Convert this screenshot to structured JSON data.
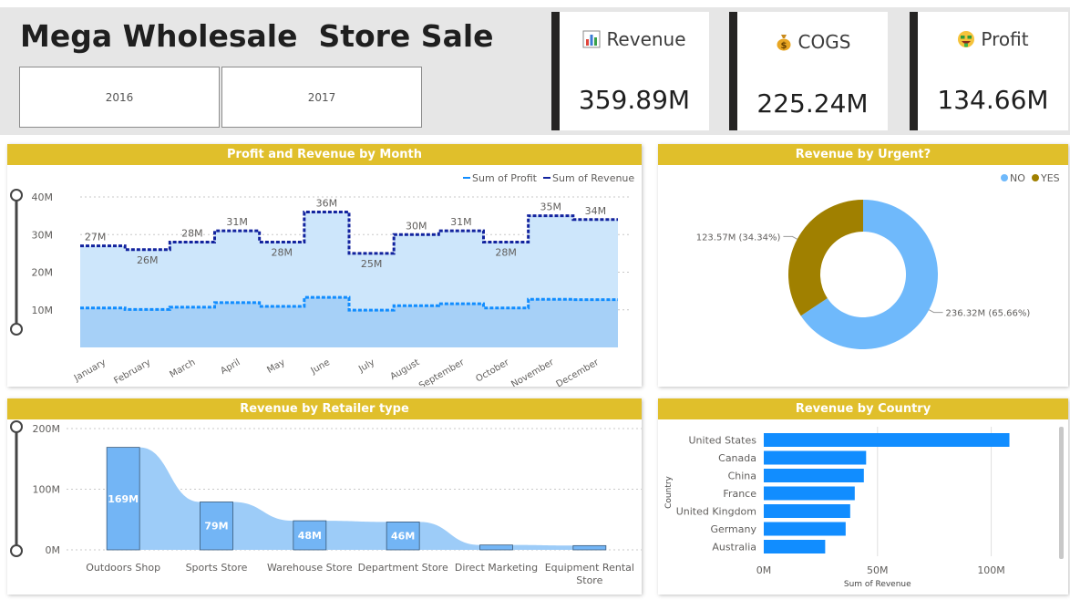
{
  "header": {
    "title": "Mega Wholesale  Store Sale",
    "slicers": [
      "2016",
      "2017"
    ]
  },
  "kpis": [
    {
      "label": "Revenue",
      "value": "359.89M",
      "icon": "bar-chart-icon"
    },
    {
      "label": "COGS",
      "value": "225.24M",
      "icon": "money-bag-icon"
    },
    {
      "label": "Profit",
      "value": "134.66M",
      "icon": "money-face-icon"
    }
  ],
  "colors": {
    "accent": "#e0bf2b",
    "revenue_line": "#12239e",
    "profit_line": "#118dff",
    "area_fill": "#cde6fb",
    "no": "#6fb9fb",
    "yes": "#a08000",
    "bar": "#118dff"
  },
  "panels": {
    "month": "Profit and Revenue by Month",
    "urgent": "Revenue by Urgent?",
    "retailer": "Revenue by Retailer type",
    "country": "Revenue by Country"
  },
  "chart_data": [
    {
      "type": "line",
      "title": "Profit and Revenue by Month",
      "categories": [
        "January",
        "February",
        "March",
        "April",
        "May",
        "June",
        "July",
        "August",
        "September",
        "October",
        "November",
        "December"
      ],
      "series": [
        {
          "name": "Sum of Profit",
          "values": [
            10.5,
            10.1,
            10.7,
            11.9,
            10.9,
            13.3,
            9.9,
            11.1,
            11.6,
            10.5,
            12.8,
            12.7
          ]
        },
        {
          "name": "Sum of Revenue",
          "values": [
            27,
            26,
            28,
            31,
            28,
            36,
            25,
            30,
            31,
            28,
            35,
            34
          ],
          "labels": [
            "27M",
            "26M",
            "28M",
            "31M",
            "28M",
            "36M",
            "25M",
            "30M",
            "31M",
            "28M",
            "35M",
            "34M"
          ]
        }
      ],
      "y_ticks": [
        "10M",
        "20M",
        "30M",
        "40M"
      ],
      "ylim": [
        0,
        40
      ],
      "legend": "top-right",
      "grid": true
    },
    {
      "type": "pie",
      "title": "Revenue by Urgent?",
      "slices": [
        {
          "name": "NO",
          "value": 236.32,
          "label": "236.32M (65.66%)"
        },
        {
          "name": "YES",
          "value": 123.57,
          "label": "123.57M (34.34%)"
        }
      ],
      "legend": "top-right"
    },
    {
      "type": "bar",
      "title": "Revenue by Retailer type",
      "categories": [
        "Outdoors Shop",
        "Sports Store",
        "Warehouse Store",
        "Department Store",
        "Direct Marketing",
        "Equipment Rental Store"
      ],
      "values": [
        169,
        79,
        48,
        46,
        8,
        7
      ],
      "labels": [
        "169M",
        "79M",
        "48M",
        "46M",
        "",
        ""
      ],
      "y_ticks": [
        "0M",
        "100M",
        "200M"
      ],
      "ylim": [
        0,
        200
      ],
      "grid": true
    },
    {
      "type": "bar",
      "orientation": "horizontal",
      "title": "Revenue by Country",
      "categories": [
        "United States",
        "Canada",
        "China",
        "France",
        "United Kingdom",
        "Germany",
        "Australia"
      ],
      "values": [
        108,
        45,
        44,
        40,
        38,
        36,
        27
      ],
      "x_ticks": [
        "0M",
        "50M",
        "100M"
      ],
      "xlim": [
        0,
        115
      ],
      "xlabel": "Sum of Revenue",
      "ylabel": "Country",
      "grid": true
    }
  ]
}
